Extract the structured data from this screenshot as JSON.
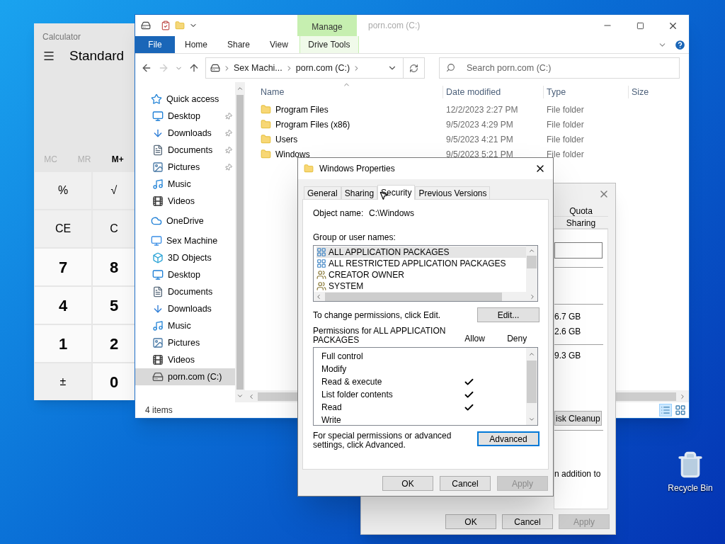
{
  "calculator": {
    "title": "Calculator",
    "mode": "Standard",
    "memory": [
      {
        "label": "MC",
        "disabled": true
      },
      {
        "label": "MR",
        "disabled": true
      },
      {
        "label": "M+",
        "disabled": false
      }
    ],
    "keys": [
      {
        "label": "%",
        "kind": "op"
      },
      {
        "label": "√",
        "kind": "op"
      },
      {
        "label": "CE",
        "kind": "op"
      },
      {
        "label": "C",
        "kind": "op"
      },
      {
        "label": "7",
        "kind": "digit"
      },
      {
        "label": "8",
        "kind": "digit"
      },
      {
        "label": "4",
        "kind": "digit"
      },
      {
        "label": "5",
        "kind": "digit"
      },
      {
        "label": "1",
        "kind": "digit"
      },
      {
        "label": "2",
        "kind": "digit"
      },
      {
        "label": "±",
        "kind": "op"
      },
      {
        "label": "0",
        "kind": "digit"
      }
    ]
  },
  "explorer": {
    "title": "porn.com (C:)",
    "context_label": "Manage",
    "ribbon_tabs": [
      {
        "label": "File",
        "kind": "file"
      },
      {
        "label": "Home",
        "kind": "tab"
      },
      {
        "label": "Share",
        "kind": "tab"
      },
      {
        "label": "View",
        "kind": "tab"
      },
      {
        "label": "Drive Tools",
        "kind": "context"
      }
    ],
    "address": [
      "Sex Machi...",
      "porn.com (C:)"
    ],
    "search": {
      "placeholder": "Search porn.com (C:)"
    },
    "nav": [
      {
        "label": "Quick access",
        "kind": "quick",
        "selected": false,
        "children": [
          {
            "label": "Desktop",
            "kind": "desktop",
            "pinned": true,
            "selected": false
          },
          {
            "label": "Downloads",
            "kind": "downloads",
            "pinned": true,
            "selected": false
          },
          {
            "label": "Documents",
            "kind": "documents",
            "pinned": true,
            "selected": false
          },
          {
            "label": "Pictures",
            "kind": "pictures",
            "pinned": true,
            "selected": false
          },
          {
            "label": "Music",
            "kind": "music",
            "pinned": false,
            "selected": false
          },
          {
            "label": "Videos",
            "kind": "videos",
            "pinned": false,
            "selected": false
          }
        ]
      },
      {
        "label": "OneDrive",
        "kind": "onedrive",
        "selected": false
      },
      {
        "label": "Sex Machine",
        "kind": "pc",
        "selected": false,
        "children": [
          {
            "label": "3D Objects",
            "kind": "objects",
            "pinned": false,
            "selected": false
          },
          {
            "label": "Desktop",
            "kind": "desktop",
            "pinned": false,
            "selected": false
          },
          {
            "label": "Documents",
            "kind": "documents",
            "pinned": false,
            "selected": false
          },
          {
            "label": "Downloads",
            "kind": "downloads",
            "pinned": false,
            "selected": false
          },
          {
            "label": "Music",
            "kind": "music",
            "pinned": false,
            "selected": false
          },
          {
            "label": "Pictures",
            "kind": "pictures",
            "pinned": false,
            "selected": false
          },
          {
            "label": "Videos",
            "kind": "videos",
            "pinned": false,
            "selected": false
          },
          {
            "label": "porn.com (C:)",
            "kind": "drive",
            "pinned": false,
            "selected": true
          }
        ]
      }
    ],
    "columns": [
      "Name",
      "Date modified",
      "Type",
      "Size"
    ],
    "rows": [
      {
        "name": "Program Files",
        "date": "12/2/2023 2:27 PM",
        "type": "File folder"
      },
      {
        "name": "Program Files (x86)",
        "date": "9/5/2023 4:29 PM",
        "type": "File folder"
      },
      {
        "name": "Users",
        "date": "9/5/2023 4:21 PM",
        "type": "File folder"
      },
      {
        "name": "Windows",
        "date": "9/5/2023 5:21 PM",
        "type": "File folder"
      }
    ],
    "status": "4 items"
  },
  "drive_dialog": {
    "tabs": [
      "Quota",
      "Sharing"
    ],
    "sizes": [
      "6.7 GB",
      "2.6 GB",
      "9.3 GB"
    ],
    "cleanup": "isk Cleanup",
    "note": "n addition to",
    "buttons": [
      {
        "label": "OK",
        "disabled": false
      },
      {
        "label": "Cancel",
        "disabled": false
      },
      {
        "label": "Apply",
        "disabled": true
      }
    ]
  },
  "properties": {
    "title": "Windows Properties",
    "tabs": [
      {
        "label": "General",
        "selected": false
      },
      {
        "label": "Sharing",
        "selected": false
      },
      {
        "label": "Security",
        "selected": true
      },
      {
        "label": "Previous Versions",
        "selected": false
      }
    ],
    "object_label": "Object name:",
    "object_value": "C:\\Windows",
    "group_label": "Group or user names:",
    "users": [
      {
        "name": "ALL APPLICATION PACKAGES",
        "kind": "package",
        "selected": true
      },
      {
        "name": "ALL RESTRICTED APPLICATION PACKAGES",
        "kind": "package",
        "selected": false
      },
      {
        "name": "CREATOR OWNER",
        "kind": "group",
        "selected": false
      },
      {
        "name": "SYSTEM",
        "kind": "group",
        "selected": false
      }
    ],
    "change_text": "To change permissions, click Edit.",
    "edit_button": "Edit...",
    "perms_label": "Permissions for ALL APPLICATION PACKAGES",
    "allow_label": "Allow",
    "deny_label": "Deny",
    "permissions": [
      {
        "name": "Full control",
        "allow": false,
        "deny": false
      },
      {
        "name": "Modify",
        "allow": false,
        "deny": false
      },
      {
        "name": "Read & execute",
        "allow": true,
        "deny": false
      },
      {
        "name": "List folder contents",
        "allow": true,
        "deny": false
      },
      {
        "name": "Read",
        "allow": true,
        "deny": false
      },
      {
        "name": "Write",
        "allow": false,
        "deny": false
      }
    ],
    "advanced_text": "For special permissions or advanced settings, click Advanced.",
    "advanced_button": "Advanced",
    "buttons": [
      {
        "label": "OK",
        "disabled": false
      },
      {
        "label": "Cancel",
        "disabled": false
      },
      {
        "label": "Apply",
        "disabled": true
      }
    ]
  },
  "desktop_icons": [
    {
      "label": "Recycle Bin"
    }
  ]
}
